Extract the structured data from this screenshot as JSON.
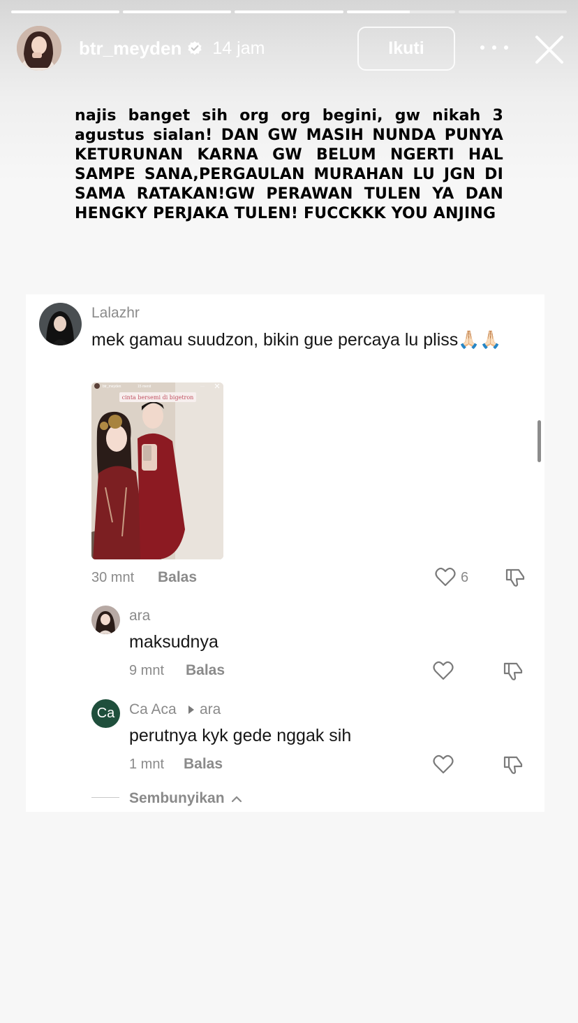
{
  "progress": [
    1,
    1,
    1,
    0.58,
    0
  ],
  "header": {
    "username": "btr_meyden",
    "time": "14 jam",
    "follow_label": "Ikuti"
  },
  "story": {
    "text": "najis banget sih org org begini, gw nikah 3 agustus sialan! DAN GW MASIH NUNDA PUNYA KETURUNAN KARNA GW   BELUM NGERTI HAL SAMPE SANA,PERGAULAN MURAHAN LU JGN DI SAMA RATAKAN!GW PERAWAN TULEN YA DAN HENGKY PERJAKA TULEN! FUCCKKK YOU ANJING"
  },
  "comments": [
    {
      "username": "Lalazhr",
      "text": "mek gamau suudzon, bikin gue percaya lu pliss🙏🏻🙏🏻",
      "time": "30 mnt",
      "reply_label": "Balas",
      "likes": "6",
      "attachment": {
        "username": "btr_meyden",
        "time": "15 menit",
        "caption": "cinta bersemi di bigetron"
      }
    }
  ],
  "replies": [
    {
      "username": "ara",
      "text": "maksudnya",
      "time": "9 mnt",
      "reply_label": "Balas"
    },
    {
      "username": "Ca Aca",
      "avatar_initials": "Ca",
      "reply_to": "ara",
      "text": "perutnya kyk gede nggak sih",
      "time": "1 mnt",
      "reply_label": "Balas"
    }
  ],
  "hide_label": "Sembunyikan",
  "colors": {
    "accent_green": "#1f4f3c",
    "muted_gray": "#8a8a8a"
  }
}
